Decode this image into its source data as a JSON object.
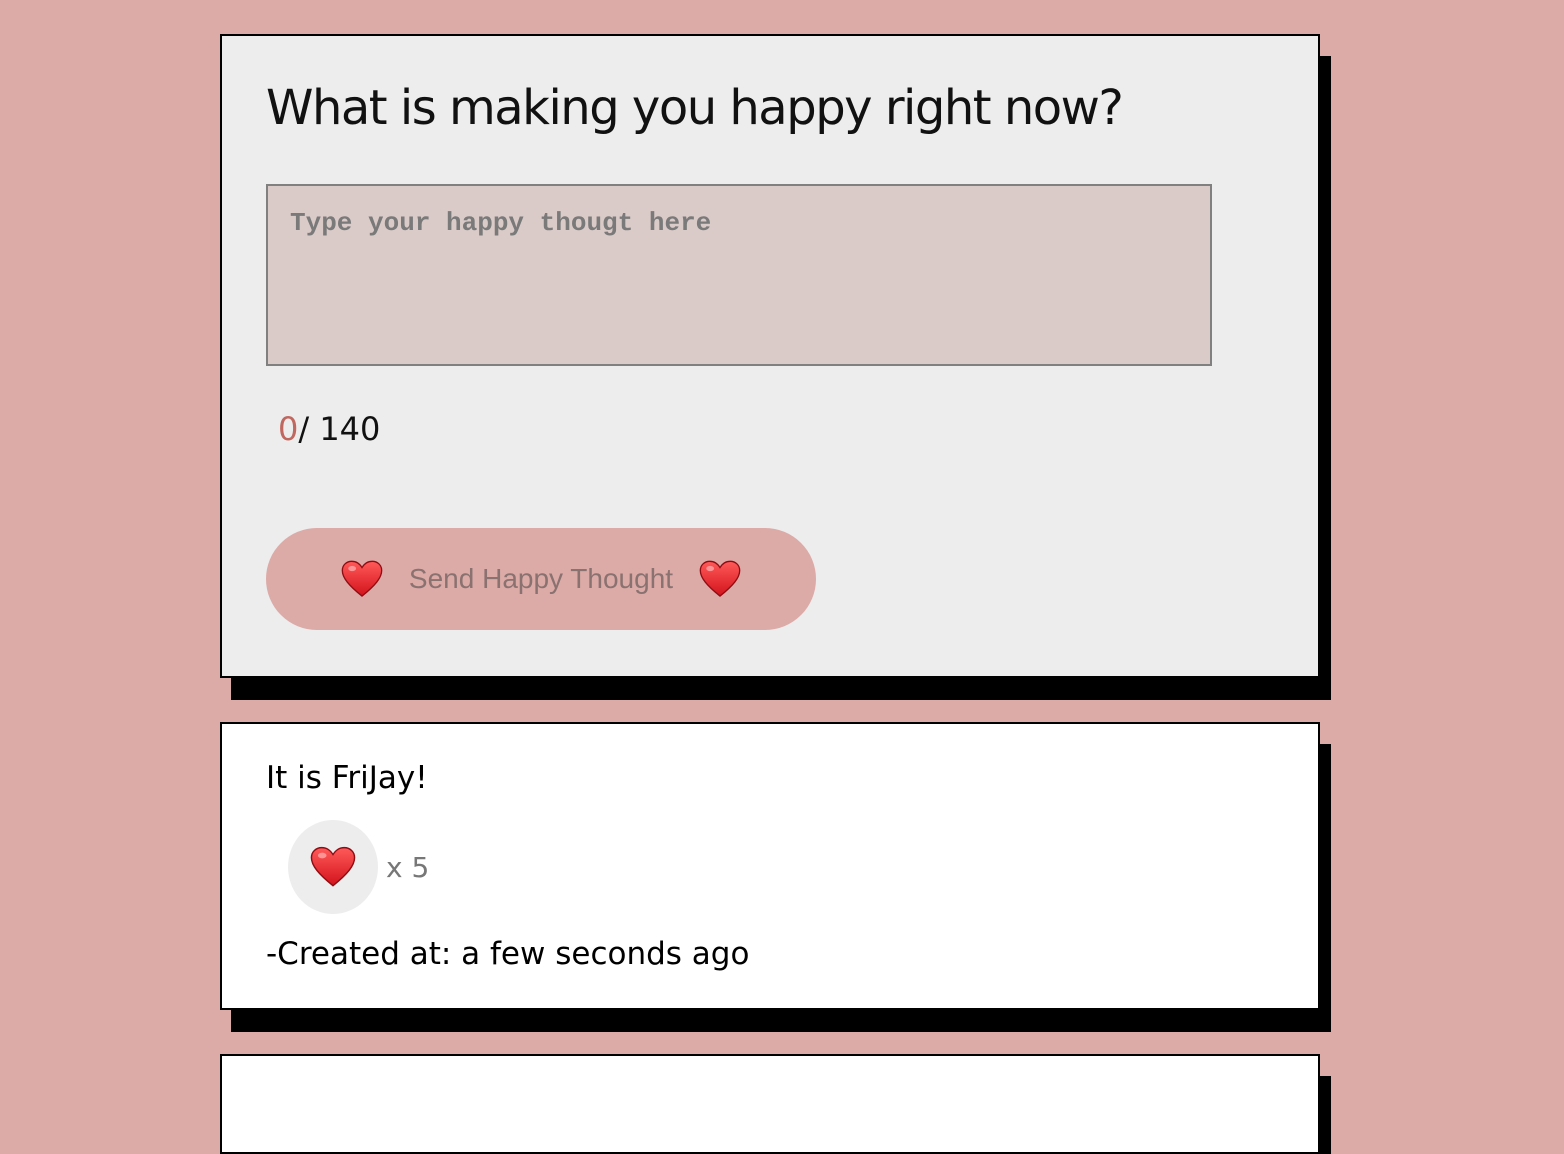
{
  "form": {
    "title": "What is making you happy right now?",
    "input_placeholder": "Type your happy thougt here",
    "input_value": "",
    "char_count": "0",
    "char_limit_text": "/ 140",
    "send_label": "Send Happy Thought",
    "send_icon": "heart-emoji"
  },
  "thoughts": [
    {
      "message": "It is FriJay!",
      "likes_text": "x 5",
      "like_icon": "heart-emoji",
      "created_text": "-Created at: a few seconds ago"
    }
  ],
  "colors": {
    "background": "#dcaaa7",
    "form_card": "#ededed",
    "input_bg": "#dbcbc8",
    "count_accent": "#c0675f",
    "button_bg": "#dcaaa7",
    "like_button_bg": "#ededed",
    "heart": "#e02a2a"
  }
}
